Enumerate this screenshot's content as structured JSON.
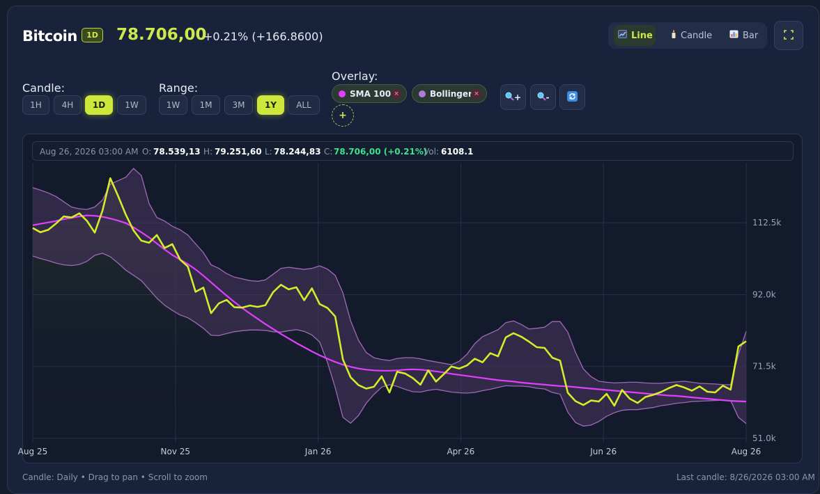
{
  "header": {
    "asset": "Bitcoin",
    "timeframe_badge": "1D",
    "price": "78.706,00",
    "change": "+0.21% (+166.8600)"
  },
  "chart_types": [
    {
      "label": "Line",
      "icon": "line-chart-icon",
      "active": true
    },
    {
      "label": "Candle",
      "icon": "candle-icon",
      "active": false
    },
    {
      "label": "Bar",
      "icon": "bar-chart-icon",
      "active": false
    }
  ],
  "candle": {
    "label": "Candle:",
    "options": [
      "1H",
      "4H",
      "1D",
      "1W"
    ],
    "selected": "1D"
  },
  "range": {
    "label": "Range:",
    "options": [
      "1W",
      "1M",
      "3M",
      "1Y",
      "ALL"
    ],
    "selected": "1Y"
  },
  "overlay": {
    "label": "Overlay:",
    "chips": [
      {
        "label": "SMA 100",
        "color": "#e040fb"
      },
      {
        "label": "Bollinger",
        "color": "#b27ad8"
      }
    ],
    "remove_glyph": "×",
    "add_glyph": "+"
  },
  "zoom": {
    "in_glyph": "+",
    "out_glyph": "-"
  },
  "ohlc": {
    "date": "Aug 26, 2026 03:00 AM",
    "o_label": "O:",
    "o": "78.539,13",
    "h_label": "H:",
    "h": "79.251,60",
    "l_label": "L:",
    "l": "78.244,83",
    "c_label": "C:",
    "c": "78.706,00 (+0.21%)",
    "vol_label": "Vol:",
    "vol": "6108.1"
  },
  "footer": {
    "left": "Candle: Daily • Drag to pan • Scroll to zoom",
    "right": "Last candle: 8/26/2026 03:00 AM"
  },
  "colors": {
    "price_line": "#d4ec2a",
    "sma": "#e040fb",
    "bollinger_fill": "#4a3660",
    "bollinger_edge": "#9e6ab8",
    "grid": "#253049"
  },
  "chart_data": {
    "type": "line",
    "x_ticks": [
      "Aug 25",
      "Nov 25",
      "Jan 26",
      "Apr 26",
      "Jun 26",
      "Aug 26"
    ],
    "y_ticks": [
      "112.5k",
      "92.0k",
      "71.5k",
      "51.0k"
    ],
    "y_tick_values": [
      112500,
      92000,
      71500,
      51000
    ],
    "ylim": [
      51000,
      130000
    ],
    "x": [
      0,
      4,
      8,
      12,
      16,
      20,
      24,
      28,
      32,
      36,
      40,
      44,
      48,
      52,
      56,
      60,
      64,
      68,
      72,
      76,
      80,
      84,
      88,
      92,
      96,
      100,
      104,
      108,
      112,
      116,
      120,
      124,
      128,
      132,
      136,
      140,
      144,
      148,
      152,
      156,
      160,
      164,
      168,
      172,
      176,
      180,
      184,
      188,
      192,
      196,
      200,
      204,
      208,
      212,
      216,
      220,
      224,
      228,
      232,
      236,
      240,
      244,
      248,
      252,
      256,
      260,
      264,
      268,
      272,
      276,
      280,
      284,
      288,
      292,
      296,
      300,
      304,
      308,
      312,
      316,
      320,
      324,
      328,
      332,
      336,
      340,
      344,
      348,
      352,
      356,
      360,
      364,
      368
    ],
    "series": [
      {
        "name": "Bitcoin",
        "values": [
          111000,
          109800,
          110500,
          112300,
          114300,
          114000,
          115200,
          113000,
          109700,
          116000,
          125200,
          120200,
          114800,
          110300,
          107400,
          106800,
          109000,
          105300,
          106400,
          102000,
          100000,
          92800,
          94000,
          86700,
          89500,
          90500,
          88400,
          88300,
          88900,
          88500,
          89000,
          92700,
          94800,
          93500,
          94100,
          90400,
          93800,
          89300,
          88200,
          85800,
          73500,
          68400,
          66200,
          65200,
          65700,
          68700,
          64100,
          70000,
          69500,
          68200,
          66300,
          70400,
          67200,
          69300,
          71500,
          70900,
          71800,
          73700,
          72700,
          75300,
          74400,
          79800,
          81000,
          80000,
          78600,
          77000,
          76800,
          74000,
          73200,
          64000,
          61600,
          60500,
          61800,
          61500,
          63700,
          60300,
          64800,
          62300,
          61100,
          62800,
          63400,
          64200,
          65300,
          66200,
          65500,
          64600,
          65800,
          64300,
          64100,
          66000,
          64900,
          77200,
          78700
        ]
      },
      {
        "name": "SMA 100",
        "values": [
          111800,
          112200,
          112600,
          113000,
          113500,
          113900,
          114300,
          114600,
          114500,
          114200,
          113700,
          113100,
          112400,
          111200,
          109800,
          108300,
          106600,
          104900,
          103300,
          102000,
          100700,
          99200,
          97400,
          95500,
          93600,
          91700,
          89900,
          88200,
          86600,
          85100,
          83600,
          82200,
          80800,
          79500,
          78200,
          77000,
          75800,
          74700,
          73700,
          72800,
          72000,
          71400,
          70900,
          70600,
          70400,
          70300,
          70300,
          70400,
          70600,
          70700,
          70600,
          70400,
          70100,
          69800,
          69400,
          69100,
          68800,
          68500,
          68200,
          67900,
          67600,
          67400,
          67200,
          66900,
          66700,
          66500,
          66300,
          66100,
          65900,
          65800,
          65600,
          65400,
          65200,
          65000,
          64800,
          64600,
          64400,
          64200,
          64000,
          63800,
          63600,
          63400,
          63200,
          63100,
          62900,
          62700,
          62500,
          62300,
          62100,
          61900,
          61700,
          61600,
          61500
        ]
      },
      {
        "name": "Bollinger Upper",
        "values": [
          122500,
          121800,
          121000,
          120000,
          118500,
          117000,
          116500,
          116300,
          117000,
          119000,
          123500,
          124500,
          125500,
          128000,
          126000,
          118000,
          114000,
          113000,
          111500,
          110500,
          109000,
          106500,
          104000,
          100500,
          99500,
          98000,
          97000,
          96500,
          96000,
          95800,
          96200,
          97800,
          99500,
          99800,
          99500,
          99200,
          99500,
          100200,
          99300,
          97500,
          92500,
          84500,
          79000,
          75500,
          74000,
          73500,
          73200,
          73800,
          74000,
          74000,
          73700,
          73200,
          72800,
          72400,
          72000,
          73000,
          75000,
          78000,
          80000,
          81000,
          82000,
          84000,
          84500,
          83500,
          82200,
          82400,
          82700,
          84300,
          84300,
          81300,
          75500,
          70800,
          68600,
          67300,
          67000,
          66800,
          66900,
          67000,
          67000,
          66800,
          66700,
          66700,
          66900,
          67100,
          67300,
          67000,
          66700,
          66600,
          66500,
          66300,
          66300,
          75000,
          81500
        ]
      },
      {
        "name": "Bollinger Lower",
        "values": [
          103000,
          102300,
          101700,
          101000,
          100500,
          100300,
          100600,
          101500,
          103200,
          103800,
          102800,
          101000,
          99000,
          97500,
          96000,
          93500,
          91000,
          89000,
          87500,
          86200,
          85400,
          84000,
          82400,
          80400,
          80300,
          80900,
          81400,
          81700,
          81900,
          81900,
          81800,
          81400,
          81300,
          81700,
          82000,
          81500,
          80500,
          78500,
          72700,
          65500,
          57000,
          55300,
          57500,
          61000,
          63500,
          65600,
          66300,
          65800,
          65000,
          64300,
          64200,
          64700,
          65000,
          64600,
          64200,
          64000,
          63900,
          64100,
          64600,
          65000,
          65500,
          66000,
          65900,
          65900,
          65700,
          65300,
          65100,
          64100,
          63600,
          58500,
          55500,
          54500,
          54800,
          55800,
          57300,
          58300,
          59000,
          59200,
          59200,
          59500,
          59800,
          60300,
          60600,
          61000,
          61200,
          61500,
          61600,
          61700,
          61800,
          61900,
          61800,
          57000,
          55200
        ]
      }
    ]
  }
}
